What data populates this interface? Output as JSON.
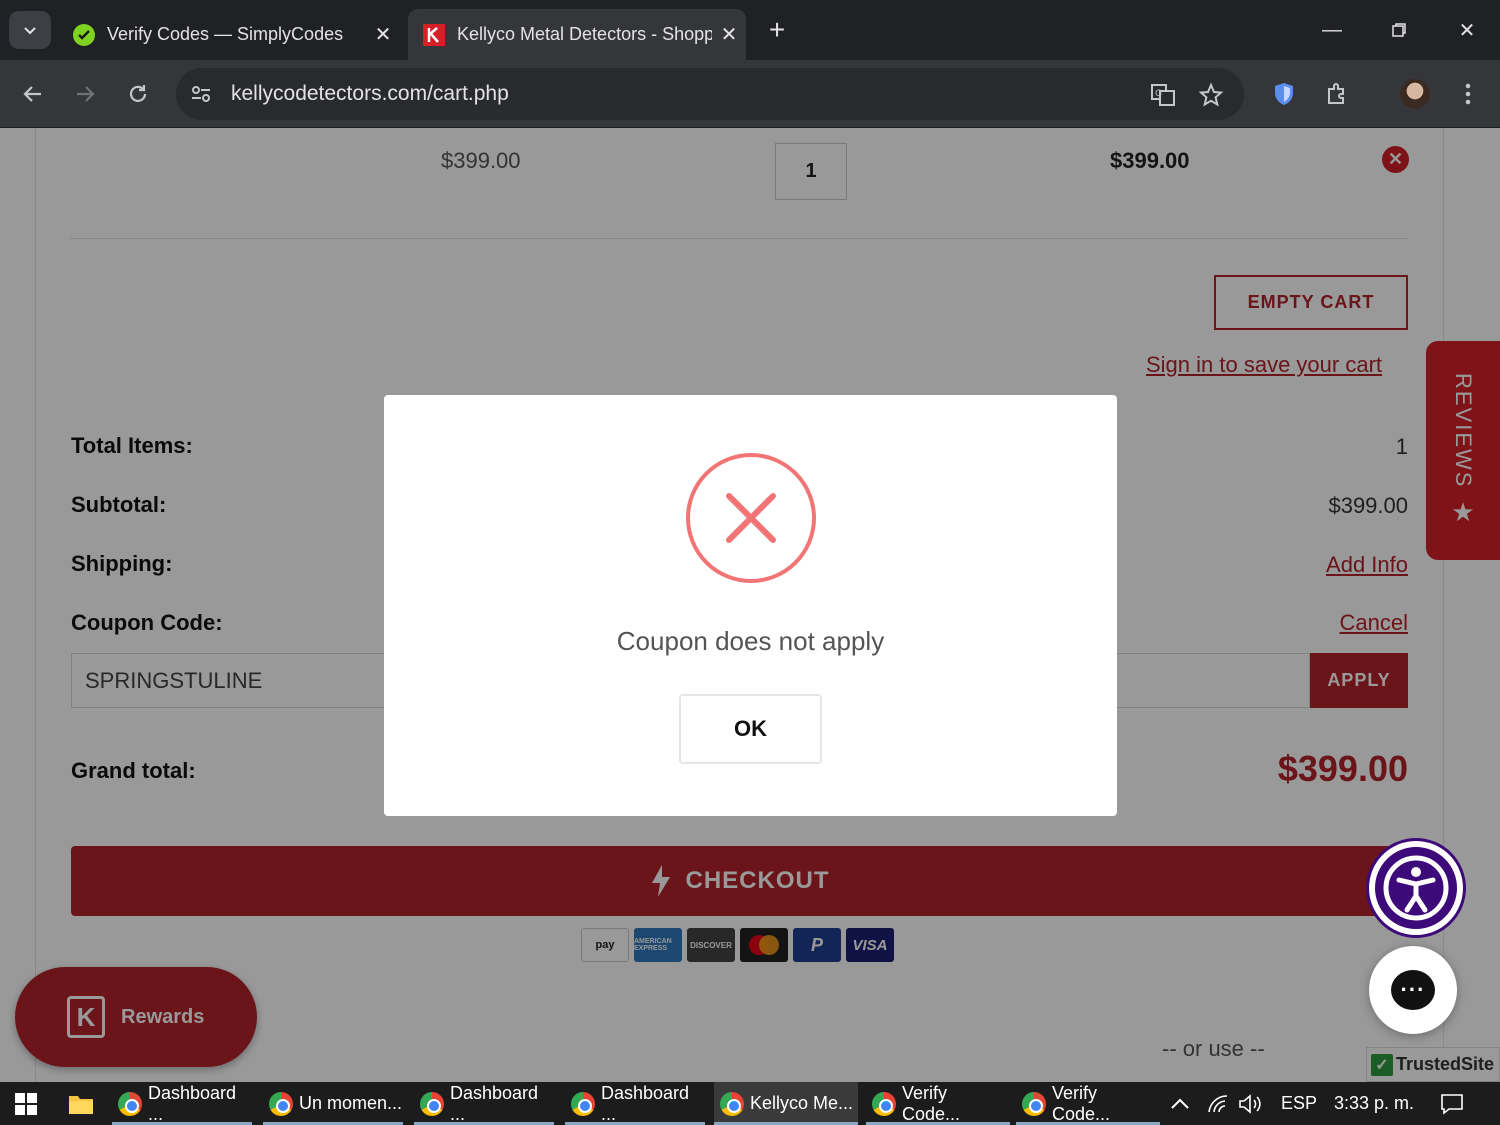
{
  "browser": {
    "tabs": [
      {
        "title": "Verify Codes — SimplyCodes",
        "active": false
      },
      {
        "title": "Kellyco Metal Detectors - Shopp",
        "active": true
      }
    ],
    "url": "kellycodetectors.com/cart.php"
  },
  "cart": {
    "item": {
      "price": "$399.00",
      "quantity": "1",
      "total": "$399.00"
    },
    "empty_cart_label": "EMPTY CART",
    "sign_in_link": "Sign in to save your cart",
    "summary": {
      "total_items_label": "Total Items:",
      "total_items_value": "1",
      "subtotal_label": "Subtotal:",
      "subtotal_value": "$399.00",
      "shipping_label": "Shipping:",
      "shipping_link": "Add Info",
      "coupon_label": "Coupon Code:",
      "coupon_cancel": "Cancel",
      "coupon_value": "SPRINGSTULINE",
      "apply_label": "APPLY",
      "grand_total_label": "Grand total:",
      "grand_total_value": "$399.00"
    },
    "checkout_label": "CHECKOUT",
    "payment_methods": [
      "pay",
      "AMERICAN EXPRESS",
      "DISCOVER",
      "mastercard",
      "PayPal",
      "VISA"
    ],
    "or_use": "-- or use --"
  },
  "widgets": {
    "reviews_label": "REVIEWS",
    "rewards_label": "Rewards",
    "trusted_site": "TrustedSite",
    "chat_dots": "···"
  },
  "dialog": {
    "message": "Coupon does not apply",
    "ok_label": "OK"
  },
  "taskbar": {
    "items": [
      "Dashboard ...",
      "Un momen...",
      "Dashboard ...",
      "Dashboard ...",
      "Kellyco Me...",
      "Verify Code...",
      "Verify Code..."
    ],
    "language": "ESP",
    "time": "3:33 p. m."
  },
  "colors": {
    "brand_red": "#b3222b",
    "error_red": "#f27474",
    "accessibility_purple": "#3d0a7a"
  }
}
